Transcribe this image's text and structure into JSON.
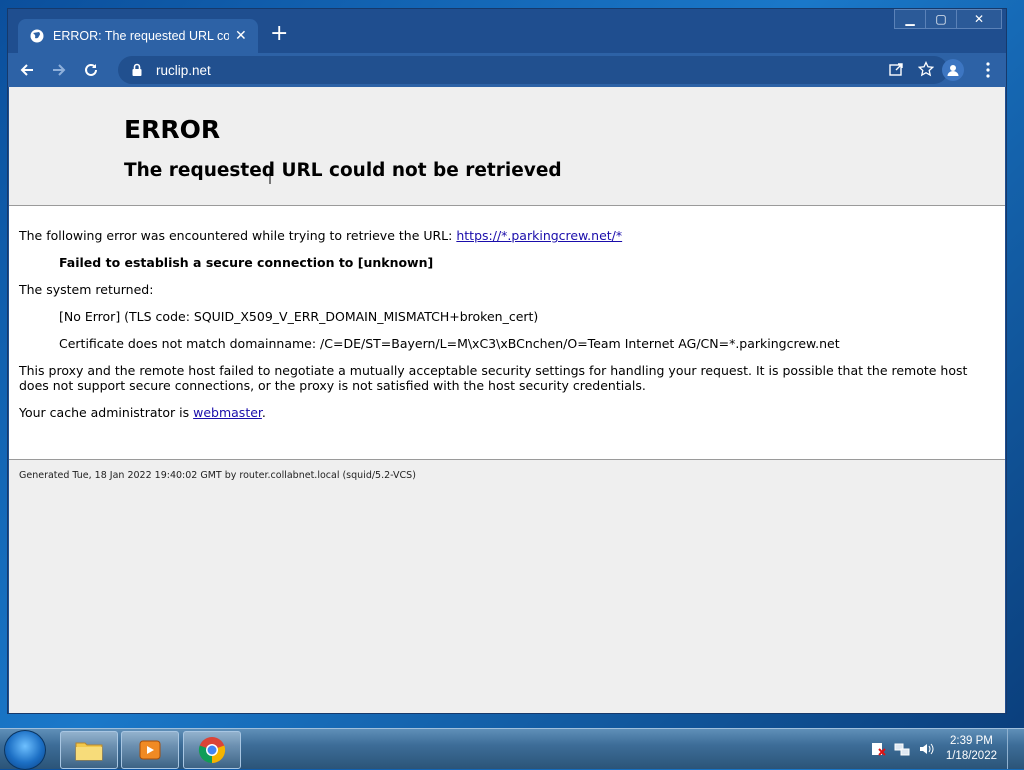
{
  "browser": {
    "tab_title": "ERROR: The requested URL could",
    "url": "ruclip.net"
  },
  "page": {
    "h1": "ERROR",
    "h2": "The requested URL could not be retrieved",
    "p1_text": "The following error was encountered while trying to retrieve the URL: ",
    "p1_link": "https://*.parkingcrew.net/*",
    "failed": "Failed to establish a secure connection to [unknown]",
    "system_returned": "The system returned:",
    "no_error": "[No Error] (TLS code: SQUID_X509_V_ERR_DOMAIN_MISMATCH+broken_cert)",
    "cert_msg": "Certificate does not match domainname: /C=DE/ST=Bayern/L=M\\xC3\\xBCnchen/O=Team Internet AG/CN=*.parkingcrew.net",
    "proxy_msg": "This proxy and the remote host failed to negotiate a mutually acceptable security settings for handling your request. It is possible that the remote host does not support secure connections, or the proxy is not satisfied with the host security credentials.",
    "cache_admin_text": "Your cache administrator is ",
    "cache_admin_link": "webmaster",
    "cache_admin_end": ".",
    "generated": "Generated Tue, 18 Jan 2022 19:40:02 GMT by router.collabnet.local (squid/5.2-VCS)"
  },
  "taskbar": {
    "time": "2:39 PM",
    "date": "1/18/2022"
  },
  "icons": {
    "tab": "globe-icon",
    "lock": "lock-icon",
    "share": "share-icon",
    "bookmark": "star-icon",
    "profile": "profile-icon",
    "menu": "kebab-menu-icon"
  }
}
